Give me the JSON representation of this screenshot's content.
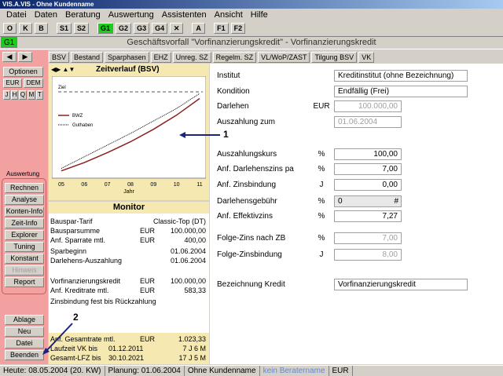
{
  "window": {
    "title": "VIS.A.VIS - Ohne Kundenname"
  },
  "menu": [
    "Datei",
    "Daten",
    "Beratung",
    "Auswertung",
    "Assistenten",
    "Ansicht",
    "Hilfe"
  ],
  "toolbar": [
    "O",
    "K",
    "B",
    "S1",
    "S2",
    "G1",
    "G2",
    "G3",
    "G4",
    "✕",
    "A",
    "F1",
    "F2"
  ],
  "heading": {
    "badge": "G1",
    "text": "Geschäftsvorfall \"Vorfinanzierungskredit\" - Vorfinanzierungskredit"
  },
  "left": {
    "optionen": "Optionen",
    "eur": "EUR",
    "dem": "DEM",
    "periods": [
      "J",
      "H",
      "Q",
      "M",
      "T"
    ],
    "auswertung": "Auswertung",
    "buttons": [
      "Rechnen",
      "Analyse",
      "Konten-Info",
      "Zeit-Info",
      "Explorer",
      "Tuning",
      "Konstant",
      "Hinweis",
      "Report"
    ],
    "bottom": [
      "Ablage",
      "Neu",
      "Datei",
      "Beenden"
    ]
  },
  "tabs": [
    "BSV",
    "Bestand",
    "Sparphasen",
    "EHZ",
    "Unreg. SZ",
    "Regelm. SZ",
    "VL/WoP/ZAST",
    "Tilgung BSV",
    "VK"
  ],
  "chart": {
    "header": "Zeitverlauf (BSV)",
    "ziel": "Ziel",
    "legend": [
      "BWZ",
      "Guthaben"
    ],
    "xlabel": "Jahr",
    "xticks": [
      "05",
      "06",
      "07",
      "08",
      "09",
      "10",
      "11"
    ]
  },
  "chart_data": {
    "type": "line",
    "x": [
      "05",
      "06",
      "07",
      "08",
      "09",
      "10",
      "11"
    ],
    "series": [
      {
        "name": "BWZ",
        "values": [
          0.05,
          0.15,
          0.27,
          0.4,
          0.55,
          0.72,
          0.92
        ],
        "color": "#8b2020"
      },
      {
        "name": "Guthaben",
        "values": [
          0.08,
          0.22,
          0.36,
          0.5,
          0.65,
          0.8,
          0.98
        ],
        "color": "#000000"
      }
    ],
    "target_line": "Ziel"
  },
  "monitor": {
    "header": "Monitor",
    "rows": [
      {
        "label": "Bauspar-Tarif",
        "cur": "",
        "value": "Classic-Top (DT)"
      },
      {
        "label": "Bausparsumme",
        "cur": "EUR",
        "value": "100.000,00"
      },
      {
        "label": "Anf. Sparrate mtl.",
        "cur": "EUR",
        "value": "400,00"
      },
      {
        "label": "Sparbeginn",
        "cur": "",
        "value": "01.06.2004"
      },
      {
        "label": "Darlehens-Auszahlung",
        "cur": "",
        "value": "01.06.2004"
      },
      {
        "label": "Vorfinanzierungskredit",
        "cur": "EUR",
        "value": "100.000,00"
      },
      {
        "label": "Anf. Kreditrate mtl.",
        "cur": "EUR",
        "value": "583,33"
      },
      {
        "label": "Zinsbindung fest bis Rückzahlung",
        "cur": "",
        "value": ""
      },
      {
        "label": "Anf. Gesamtrate mtl.",
        "cur": "EUR",
        "value": "1.023,33"
      },
      {
        "label": "Laufzeit VK bis",
        "cur": "01.12.2011",
        "value": "7 J 6 M"
      },
      {
        "label": "Gesamt-LFZ bis",
        "cur": "30.10.2021",
        "value": "17 J 5 M"
      }
    ]
  },
  "form": {
    "institut": {
      "label": "Institut",
      "value": "Kreditinstitut (ohne Bezeichnung)"
    },
    "kondition": {
      "label": "Kondition",
      "value": "Endfällig  (Frei)"
    },
    "darlehen": {
      "label": "Darlehen",
      "cur": "EUR",
      "value": "100.000,00"
    },
    "auszahlung": {
      "label": "Auszahlung zum",
      "value": "01.06.2004"
    },
    "kurs": {
      "label": "Auszahlungskurs",
      "cur": "%",
      "value": "100,00"
    },
    "darlehenszins": {
      "label": "Anf. Darlehenszins pa",
      "cur": "%",
      "value": "7,00"
    },
    "zinsbindung": {
      "label": "Anf. Zinsbindung",
      "cur": "J",
      "value": "0,00"
    },
    "gebuehr": {
      "label": "Darlehensgebühr",
      "cur": "%",
      "value": "0",
      "suffix": "#"
    },
    "effektiv": {
      "label": "Anf. Effektivzins",
      "cur": "%",
      "value": "7,27"
    },
    "folgezins": {
      "label": "Folge-Zins nach ZB",
      "cur": "%",
      "value": "7,00"
    },
    "folgebindung": {
      "label": "Folge-Zinsbindung",
      "cur": "J",
      "value": "8,00"
    },
    "bezeichnung": {
      "label": "Bezeichnung Kredit",
      "value": "Vorfinanzierungskredit"
    }
  },
  "annotations": {
    "one": "1",
    "two": "2"
  },
  "status": [
    "Heute: 08.05.2004 (20. KW)",
    "Planung: 01.06.2004",
    "Ohne Kundenname",
    "kein Beratername",
    "EUR"
  ]
}
